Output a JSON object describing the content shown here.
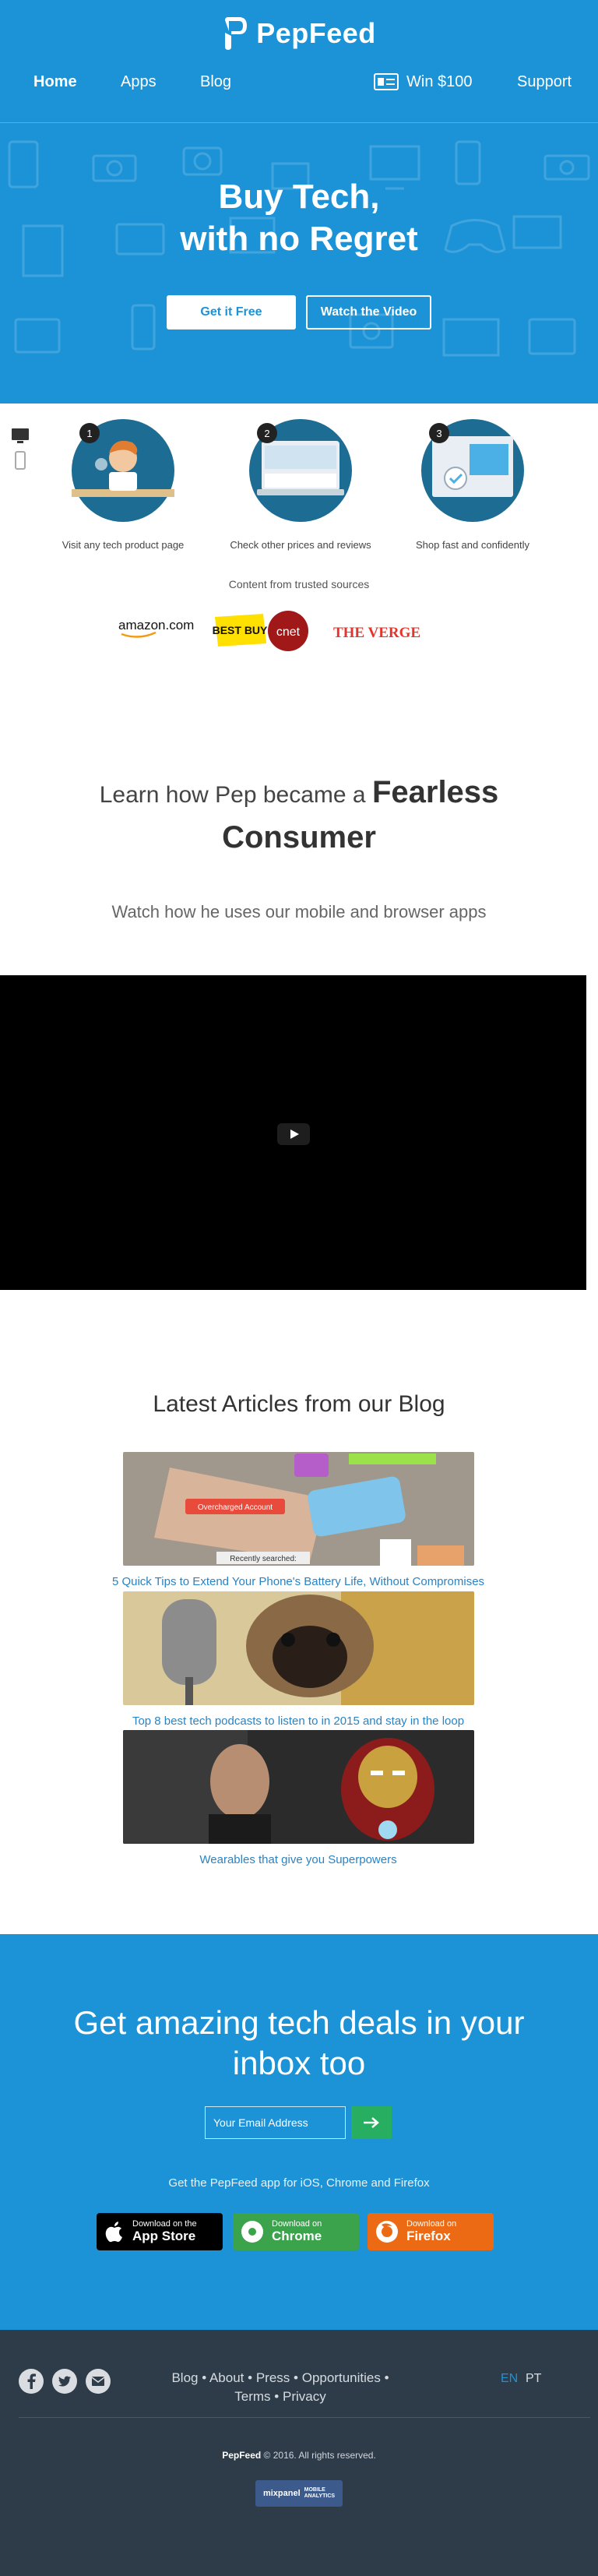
{
  "brand": {
    "name": "PepFeed"
  },
  "nav": {
    "home": "Home",
    "apps": "Apps",
    "blog": "Blog",
    "win": "Win $100",
    "support": "Support"
  },
  "hero": {
    "title_line1": "Buy Tech,",
    "title_line2": "with no Regret",
    "cta_primary": "Get it Free",
    "cta_secondary": "Watch the Video"
  },
  "steps": [
    {
      "number": "1",
      "caption": "Visit any tech product page"
    },
    {
      "number": "2",
      "caption": "Check other prices and reviews"
    },
    {
      "number": "3",
      "caption": "Shop fast and confidently"
    }
  ],
  "trusted": {
    "label": "Content from trusted sources",
    "sources": [
      "amazon.com",
      "BEST BUY",
      "cnet",
      "THE VERGE"
    ]
  },
  "learn": {
    "title_prefix": "Learn how Pep became a",
    "title_strong": "Fearless Consumer",
    "subtitle": "Watch how he uses our mobile and browser apps"
  },
  "blog": {
    "title": "Latest Articles from our Blog",
    "articles": [
      {
        "title": "5 Quick Tips to Extend Your Phone's Battery Life, Without Compromises",
        "img_texts": [
          "Overcharged Account",
          "Recently searched:"
        ]
      },
      {
        "title": "Top 8 best tech podcasts to listen to in 2015 and stay in the loop"
      },
      {
        "title": "Wearables that give you Superpowers"
      }
    ]
  },
  "newsletter": {
    "title_line1": "Get amazing tech deals in your",
    "title_line2": "inbox too",
    "email_placeholder": "Your Email Address",
    "app_note": "Get the PepFeed app for iOS, Chrome and Firefox",
    "stores": [
      {
        "small": "Download on the",
        "big": "App Store",
        "icon": "apple-icon"
      },
      {
        "small": "Download on",
        "big": "Chrome",
        "icon": "chrome-icon"
      },
      {
        "small": "Download on",
        "big": "Firefox",
        "icon": "firefox-icon"
      }
    ]
  },
  "footer": {
    "links": [
      "Blog",
      "About",
      "Press",
      "Opportunities",
      "Terms",
      "Privacy"
    ],
    "separator": "•",
    "languages": [
      "EN",
      "PT"
    ],
    "copyright_brand": "PepFeed",
    "copyright_text": "© 2016. All rights reserved.",
    "badge_name": "mixpanel",
    "badge_line1": "MOBILE",
    "badge_line2": "ANALYTICS",
    "social": [
      "facebook-icon",
      "twitter-icon",
      "email-icon"
    ]
  },
  "colors": {
    "primary_blue": "#1c93d7",
    "footer_bg": "#2e3c4a",
    "link_blue": "#2a83c4",
    "submit_green": "#27ae60",
    "chrome_green": "#3aa34c",
    "firefox_orange": "#ec6a14"
  }
}
